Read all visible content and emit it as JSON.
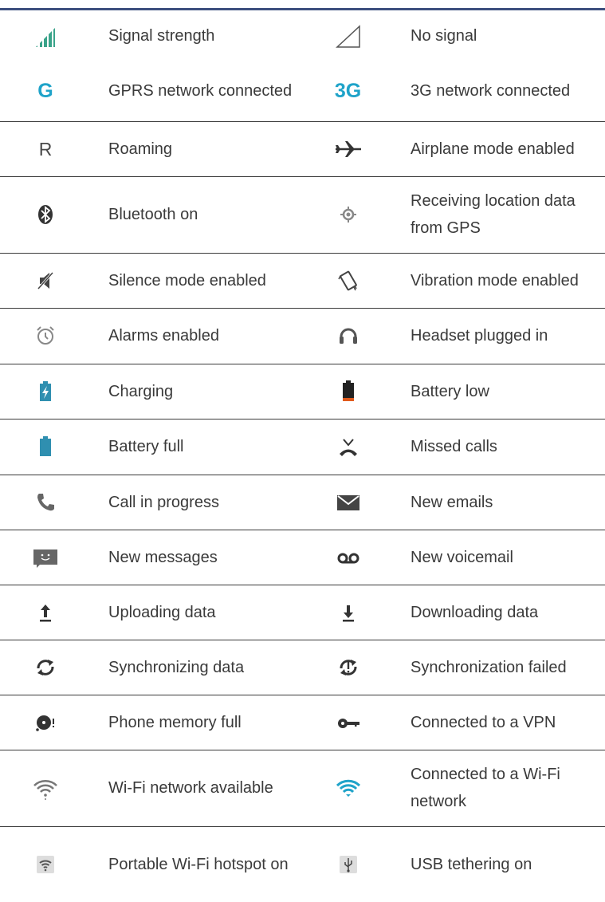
{
  "rows": [
    [
      {
        "icon": "signal-strength-icon",
        "label": "Signal strength"
      },
      {
        "icon": "no-signal-icon",
        "label": "No signal"
      }
    ],
    [
      {
        "icon": "gprs-icon",
        "label": "GPRS network connected"
      },
      {
        "icon": "3g-icon",
        "label": "3G network connected"
      }
    ],
    [
      {
        "icon": "roaming-icon",
        "label": "Roaming"
      },
      {
        "icon": "airplane-icon",
        "label": "Airplane mode enabled"
      }
    ],
    [
      {
        "icon": "bluetooth-icon",
        "label": "Bluetooth on"
      },
      {
        "icon": "gps-icon",
        "label": "Receiving location data from GPS"
      }
    ],
    [
      {
        "icon": "silence-icon",
        "label": "Silence mode enabled"
      },
      {
        "icon": "vibration-icon",
        "label": "Vibration mode enabled"
      }
    ],
    [
      {
        "icon": "alarm-icon",
        "label": "Alarms enabled"
      },
      {
        "icon": "headset-icon",
        "label": "Headset plugged in"
      }
    ],
    [
      {
        "icon": "charging-icon",
        "label": "Charging"
      },
      {
        "icon": "battery-low-icon",
        "label": "Battery low"
      }
    ],
    [
      {
        "icon": "battery-full-icon",
        "label": "Battery full"
      },
      {
        "icon": "missed-calls-icon",
        "label": "Missed calls"
      }
    ],
    [
      {
        "icon": "call-icon",
        "label": "Call in progress"
      },
      {
        "icon": "email-icon",
        "label": "New emails"
      }
    ],
    [
      {
        "icon": "message-icon",
        "label": "New messages"
      },
      {
        "icon": "voicemail-icon",
        "label": "New voicemail"
      }
    ],
    [
      {
        "icon": "upload-icon",
        "label": "Uploading data"
      },
      {
        "icon": "download-icon",
        "label": "Downloading data"
      }
    ],
    [
      {
        "icon": "sync-icon",
        "label": "Synchronizing data"
      },
      {
        "icon": "sync-failed-icon",
        "label": "Synchronization failed"
      }
    ],
    [
      {
        "icon": "memory-full-icon",
        "label": "Phone memory full"
      },
      {
        "icon": "vpn-key-icon",
        "label": "Connected to a VPN"
      }
    ],
    [
      {
        "icon": "wifi-available-icon",
        "label": "Wi-Fi network available"
      },
      {
        "icon": "wifi-connected-icon",
        "label": "Connected to a Wi-Fi network"
      }
    ],
    [
      {
        "icon": "hotspot-icon",
        "label": "Portable Wi-Fi hotspot on"
      },
      {
        "icon": "usb-tethering-icon",
        "label": "USB tethering on"
      }
    ]
  ],
  "glyphs": {
    "gprs": "G",
    "three_g": "3G",
    "roaming": "R"
  },
  "colors": {
    "accent": "#1fa3c9",
    "battery": "#2f8fb0",
    "battery_low": "#e05a1c",
    "text": "#3a3a3a",
    "icon_gray": "#555555"
  }
}
